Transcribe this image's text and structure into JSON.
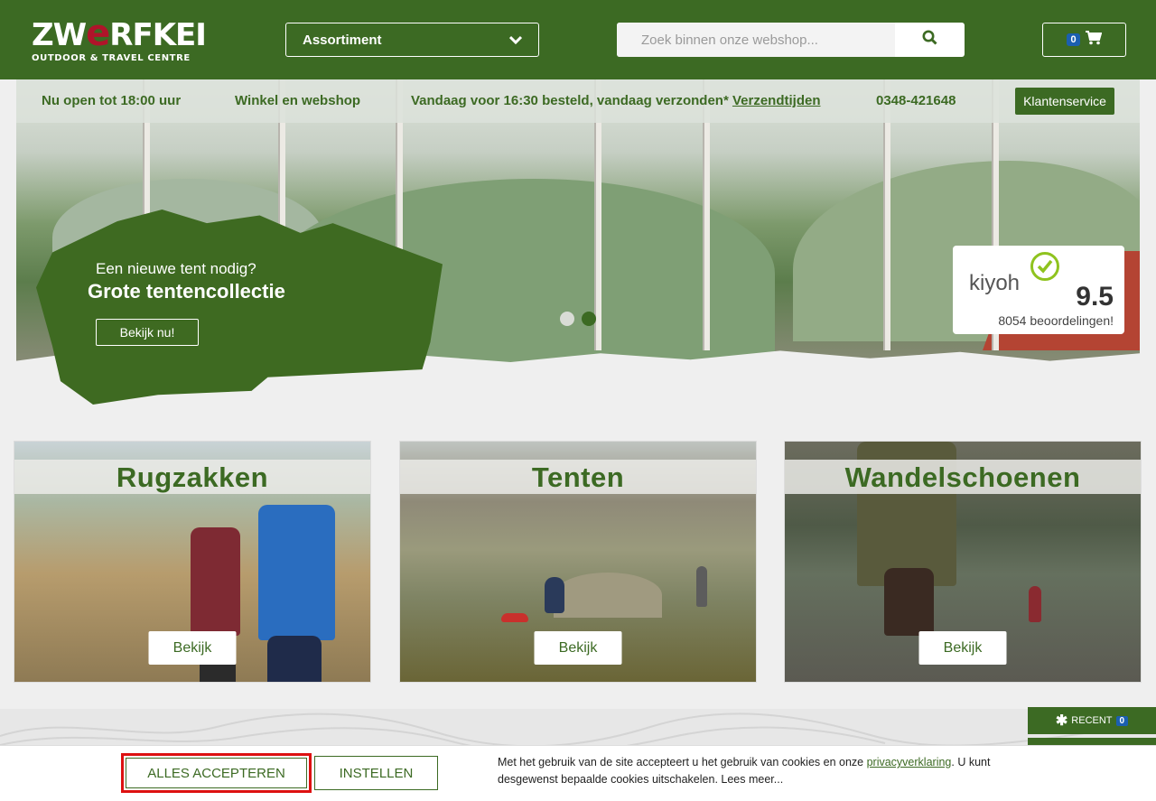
{
  "header": {
    "logo_brand_a": "ZW",
    "logo_brand_e": "e",
    "logo_brand_b": "RFKEI",
    "logo_tagline": "OUTDOOR & TRAVEL CENTRE",
    "assortiment_label": "Assortiment",
    "search_placeholder": "Zoek binnen onze webshop...",
    "cart_count": "0"
  },
  "infobar": {
    "open_text": "Nu open tot 18:00 uur",
    "shop_text": "Winkel en webshop",
    "shipping_text": "Vandaag voor 16:30 besteld, vandaag verzonden*",
    "shipping_link": "Verzendtijden",
    "phone": "0348-421648",
    "service_button": "Klantenservice"
  },
  "hero": {
    "subtitle": "Een nieuwe tent nodig?",
    "title": "Grote tentencollectie",
    "button": "Bekijk nu!",
    "slide_count": 2,
    "active_slide": 2
  },
  "kiyoh": {
    "logo": "kiyoh",
    "score": "9.5",
    "reviews": "8054 beoordelingen!"
  },
  "categories": [
    {
      "title": "Rugzakken",
      "button": "Bekijk"
    },
    {
      "title": "Tenten",
      "button": "Bekijk"
    },
    {
      "title": "Wandelschoenen",
      "button": "Bekijk"
    }
  ],
  "recent": {
    "label": "RECENT",
    "count": "0"
  },
  "cookie": {
    "accept_all": "ALLES ACCEPTEREN",
    "settings": "INSTELLEN",
    "text_before": "Met het gebruik van de site accepteert u het gebruik van cookies en onze",
    "privacy_link": "privacyverklaring",
    "text_after": ". U kunt desgewenst bepaalde cookies uitschakelen. Lees meer..."
  },
  "colors": {
    "brand_green": "#3c6a23",
    "logo_red": "#b0142a",
    "badge_blue": "#1b5fb0",
    "highlight_red": "#dd1111"
  }
}
